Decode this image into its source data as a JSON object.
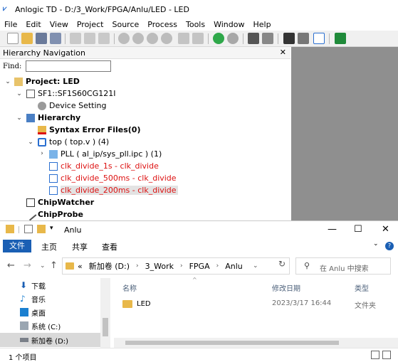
{
  "td": {
    "title": "Anlogic TD - D:/3_Work/FPGA/Anlu/LED - LED",
    "menu": [
      "File",
      "Edit",
      "View",
      "Project",
      "Source",
      "Process",
      "Tools",
      "Window",
      "Help"
    ],
    "panel_title": "Hierarchy Navigation",
    "find_label": "Find:",
    "find_value": "",
    "tree": {
      "project": "Project: LED",
      "device": "SF1::SF1S60CG121I",
      "device_setting": "Device Setting",
      "hierarchy": "Hierarchy",
      "syntax_errors": "Syntax Error Files(0)",
      "top": "top ( top.v )  (4)",
      "pll": "PLL ( al_ip/sys_pll.ipc ) (1)",
      "clk1": "clk_divide_1s - clk_divide",
      "clk2": "clk_divide_500ms - clk_divide",
      "clk3": "clk_divide_200ms - clk_divide",
      "chipwatcher": "ChipWatcher",
      "chipprobe": "ChipProbe"
    }
  },
  "explorer": {
    "title": "Anlu",
    "ribbon": {
      "file": "文件",
      "tabs": [
        "主页",
        "共享",
        "查看"
      ]
    },
    "address": [
      "«",
      "新加卷 (D:)",
      "3_Work",
      "FPGA",
      "Anlu"
    ],
    "search_placeholder": "在 Anlu 中搜索",
    "nav_items": [
      "下载",
      "音乐",
      "桌面",
      "系统 (C:)",
      "新加卷 (D:)"
    ],
    "columns": {
      "name": "名称",
      "date": "修改日期",
      "type": "类型"
    },
    "files": [
      {
        "name": "LED",
        "date": "2023/3/17 16:44",
        "type": "文件夹"
      }
    ],
    "status": "1 个项目"
  },
  "colors": {
    "accent": "#1a5fb4",
    "error_red": "#d11111",
    "folder": "#e8b84a"
  }
}
